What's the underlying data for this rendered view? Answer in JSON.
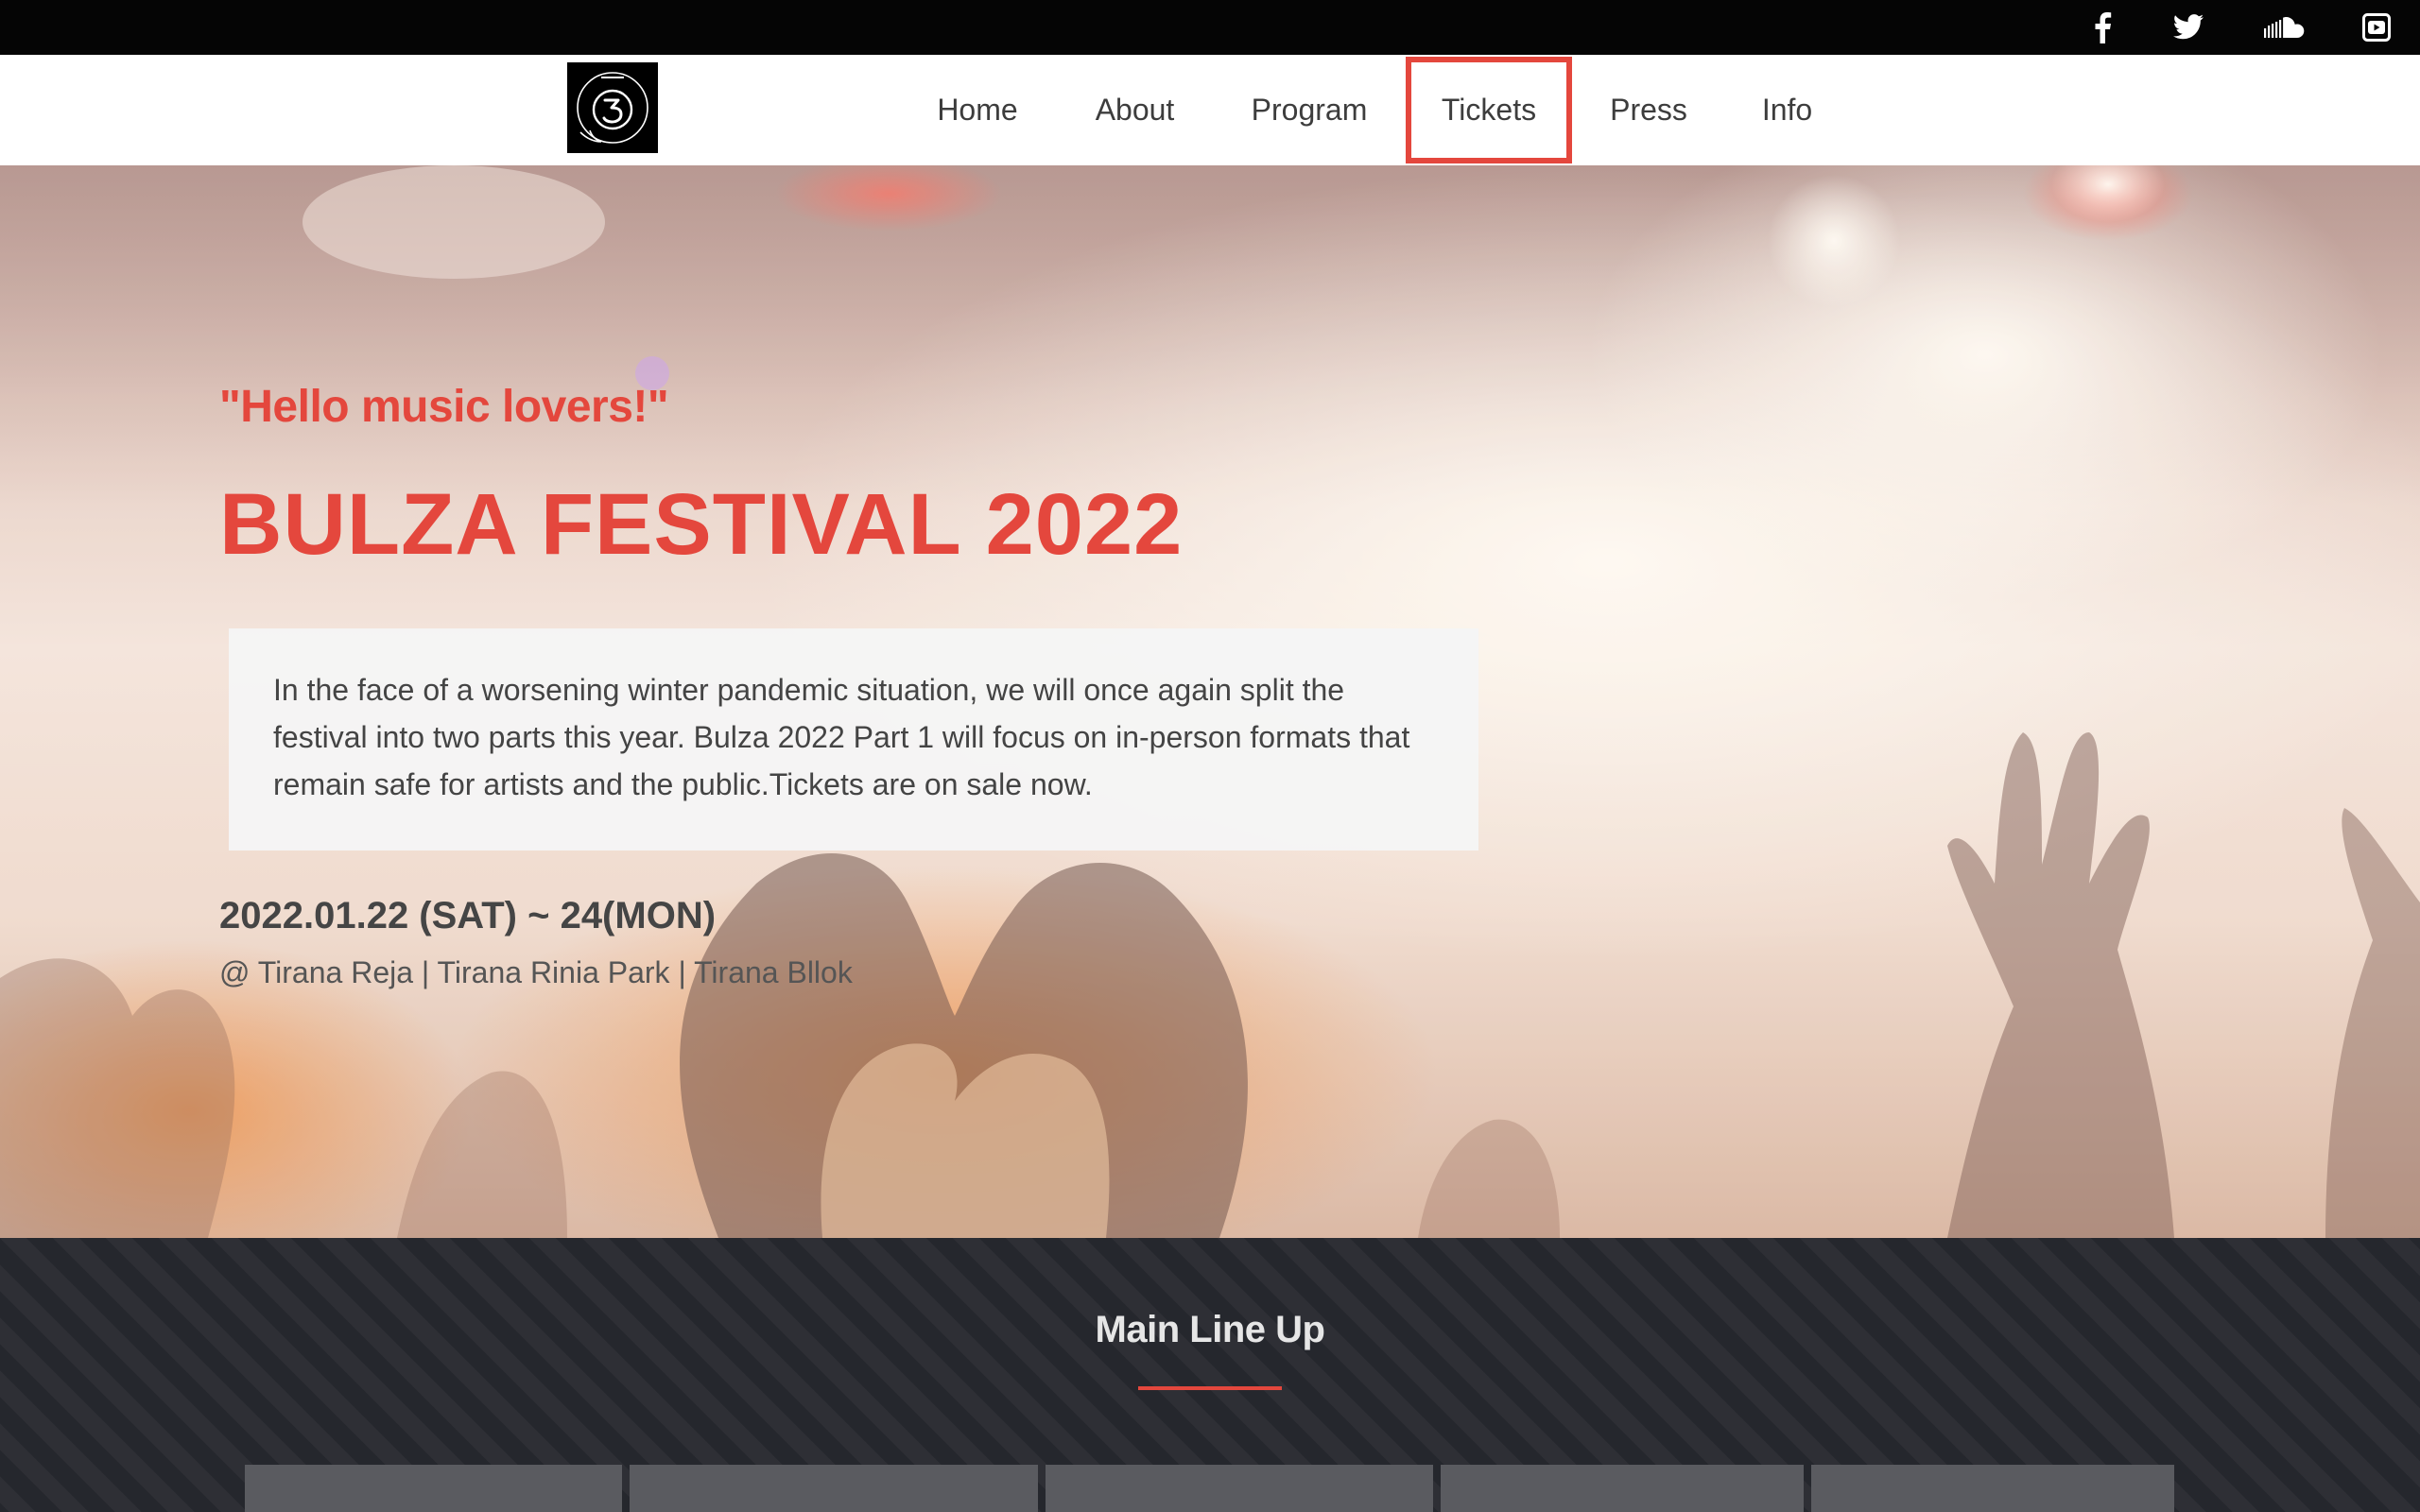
{
  "topbar": {
    "icons": [
      "facebook-icon",
      "twitter-icon",
      "soundcloud-icon",
      "youtube-icon"
    ]
  },
  "nav": {
    "logo_icon": "bulza-logo",
    "items": [
      {
        "label": "Home"
      },
      {
        "label": "About"
      },
      {
        "label": "Program"
      },
      {
        "label": "Tickets"
      },
      {
        "label": "Press"
      },
      {
        "label": "Info"
      }
    ],
    "highlighted": "Tickets"
  },
  "hero": {
    "greeting": "\"Hello music lovers!\"",
    "title": "BULZA FESTIVAL 2022",
    "description": "In the face of a worsening winter pandemic situation, we will once again split the festival into two parts this year. Bulza 2022 Part 1 will focus on in-person formats that remain safe for artists and the public.Tickets are on sale now.",
    "date": "2022.01.22 (SAT) ~ 24(MON)",
    "venue": "@ Tirana Reja | Tirana Rinia Park | Tirana Bllok"
  },
  "lineup": {
    "title": "Main Line Up"
  },
  "colors": {
    "accent": "#e4473d",
    "topbar_bg": "#050505",
    "lineup_bg": "#25272d",
    "card_bg": "#f5f5f5"
  }
}
